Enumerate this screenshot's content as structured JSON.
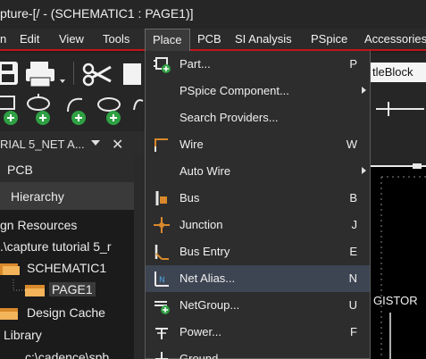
{
  "window": {
    "title": "pture-[/ - (SCHEMATIC1 : PAGE1)]"
  },
  "menubar": {
    "items": [
      {
        "id": "file",
        "label": "n"
      },
      {
        "id": "edit",
        "label": "Edit"
      },
      {
        "id": "view",
        "label": "View"
      },
      {
        "id": "tools",
        "label": "Tools"
      },
      {
        "id": "place",
        "label": "Place"
      },
      {
        "id": "pcb",
        "label": "PCB"
      },
      {
        "id": "si",
        "label": "SI Analysis"
      },
      {
        "id": "pspice",
        "label": "PSpice"
      },
      {
        "id": "accessories",
        "label": "Accessories"
      }
    ]
  },
  "toolbar": {
    "titleblock_field": "tleBlock"
  },
  "panel": {
    "header": "RIAL 5_NET A...",
    "tabs": {
      "pcb": "PCB",
      "hierarchy": "Hierarchy"
    },
    "tree": [
      {
        "label": "gn Resources"
      },
      {
        "label": ".\\capture tutorial 5_r"
      },
      {
        "label": "SCHEMATIC1"
      },
      {
        "label": "PAGE1"
      },
      {
        "label": "Design Cache"
      },
      {
        "label": "Library"
      },
      {
        "label": "c:\\cadence\\spb"
      }
    ]
  },
  "canvas": {
    "text": "GISTOR"
  },
  "place_menu": {
    "items": [
      {
        "label": "Part...",
        "shortcut": "P",
        "icon": "part-icon"
      },
      {
        "label": "PSpice Component...",
        "shortcut": "",
        "submenu": true
      },
      {
        "label": "Search Providers...",
        "shortcut": ""
      },
      {
        "label": "Wire",
        "shortcut": "W",
        "icon": "wire-icon"
      },
      {
        "label": "Auto Wire",
        "shortcut": "",
        "submenu": true
      },
      {
        "label": "Bus",
        "shortcut": "B",
        "icon": "bus-icon"
      },
      {
        "label": "Junction",
        "shortcut": "J",
        "icon": "junction-icon"
      },
      {
        "label": "Bus Entry",
        "shortcut": "E",
        "icon": "bus-entry-icon"
      },
      {
        "label": "Net Alias...",
        "shortcut": "N",
        "icon": "net-alias-icon",
        "highlighted": true
      },
      {
        "label": "NetGroup...",
        "shortcut": "U",
        "icon": "netgroup-icon"
      },
      {
        "label": "Power...",
        "shortcut": "F",
        "icon": "power-icon"
      },
      {
        "label": "Ground...",
        "shortcut": "",
        "icon": "ground-icon"
      }
    ]
  },
  "colors": {
    "accent": "#c0151c",
    "highlight": "#3d4452",
    "icon_green": "#2fa043",
    "icon_orange": "#d9892b"
  }
}
